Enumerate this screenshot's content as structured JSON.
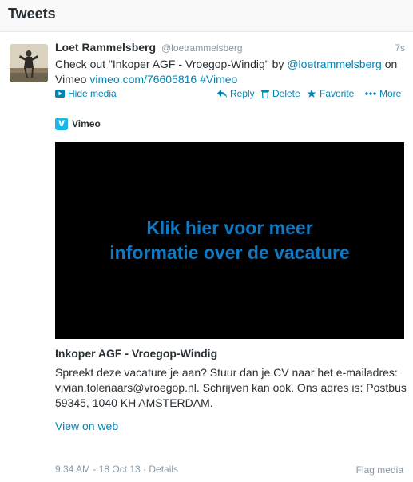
{
  "header": {
    "title": "Tweets"
  },
  "tweet": {
    "name": "Loet Rammelsberg",
    "handle": "@loetrammelsberg",
    "time": "7s",
    "text_prefix": "Check out \"Inkoper AGF - Vroegop-Windig\" by ",
    "mention": "@loetrammelsberg",
    "text_on": " on Vimeo ",
    "link": "vimeo.com/76605816",
    "hashtag": "#Vimeo",
    "actions": {
      "hide_media": "Hide media",
      "reply": "Reply",
      "delete": "Delete",
      "favorite": "Favorite",
      "more": "More"
    },
    "card": {
      "provider": "Vimeo",
      "video_text": "Klik hier voor meer informatie over de vacature",
      "title": "Inkoper AGF - Vroegop-Windig",
      "description": "Spreekt deze vacature je aan? Stuur dan je CV naar het e-mailadres: vivian.tolenaars@vroegop.nl. Schrijven kan ook. Ons adres is: Postbus 59345, 1040 KH AMSTERDAM.",
      "view_on_web": "View on web"
    },
    "timestamp": "9:34 AM - 18 Oct 13 · Details",
    "flag_media": "Flag media"
  },
  "colors": {
    "link": "#0084b4",
    "vimeo": "#1ab7ea",
    "video_text": "#0d7ac6"
  }
}
